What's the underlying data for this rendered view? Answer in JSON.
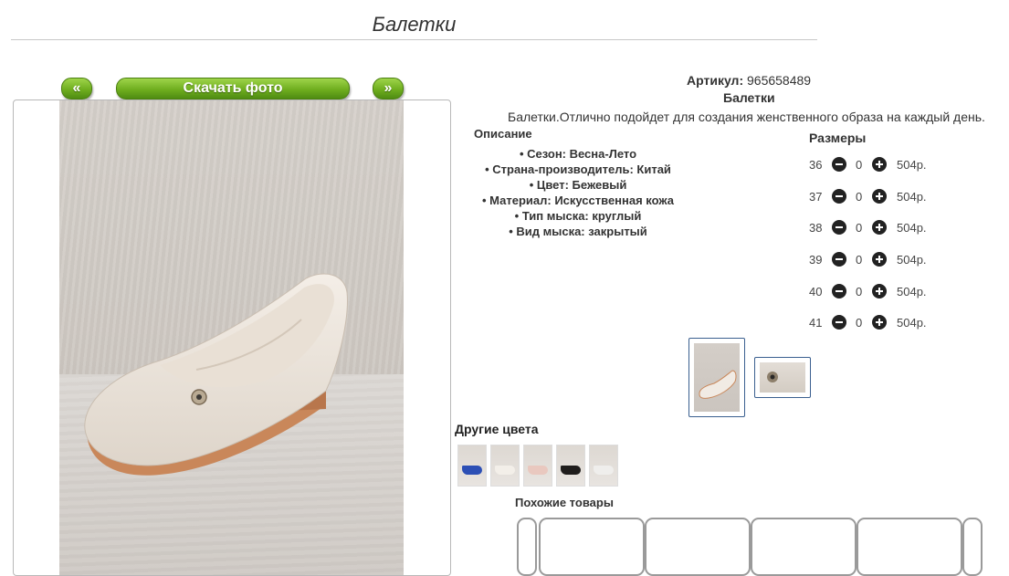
{
  "page": {
    "title": "Балетки"
  },
  "gallery": {
    "prev_label": "«",
    "download_label": "Скачать фото",
    "next_label": "»"
  },
  "product": {
    "article_label": "Артикул:",
    "article_value": "965658489",
    "name": "Балетки",
    "description": "Балетки.Отлично подойдет для создания женственного образа на каждый день.",
    "description_heading": "Описание",
    "specs": [
      "Сезон: Весна-Лето",
      "Страна-производитель: Китай",
      "Цвет: Бежевый",
      "Материал: Искусственная кожа",
      "Тип мыска: круглый",
      "Вид мыска: закрытый"
    ]
  },
  "sizes": {
    "heading": "Размеры",
    "rows": [
      {
        "size": "36",
        "qty": "0",
        "price": "504р."
      },
      {
        "size": "37",
        "qty": "0",
        "price": "504р."
      },
      {
        "size": "38",
        "qty": "0",
        "price": "504р."
      },
      {
        "size": "39",
        "qty": "0",
        "price": "504р."
      },
      {
        "size": "40",
        "qty": "0",
        "price": "504р."
      },
      {
        "size": "41",
        "qty": "0",
        "price": "504р."
      }
    ]
  },
  "other_colors": {
    "heading": "Другие цвета",
    "swatch_colors": [
      "#2c4fb5",
      "#f3efe9",
      "#e9c8bf",
      "#1f1d1c",
      "#efeeec"
    ]
  },
  "similar": {
    "heading": "Похожие товары"
  },
  "colors": {
    "button_green": "#6fae1f",
    "thumb_border": "#3a5f8f"
  }
}
